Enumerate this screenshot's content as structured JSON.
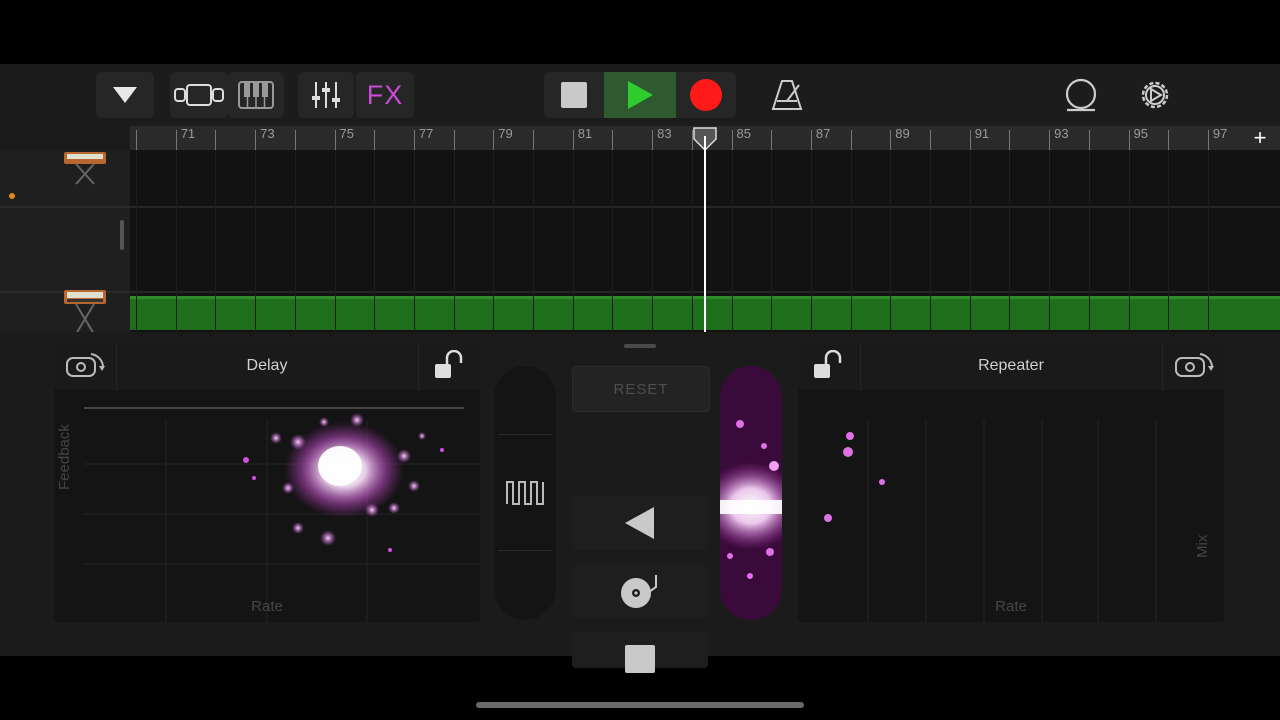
{
  "toolbar": {
    "fx_label": "FX",
    "icons": [
      "dropdown-arrow-icon",
      "tracks-view-icon",
      "keyboard-icon",
      "mixer-icon",
      "stop-icon",
      "play-icon",
      "record-icon",
      "metronome-icon",
      "loop-icon",
      "settings-icon"
    ],
    "colors": {
      "fx": "#c84bd6",
      "play": "#2ecc2e",
      "record": "#ff1a1a"
    }
  },
  "ruler": {
    "bars": [
      "71",
      "73",
      "75",
      "77",
      "79",
      "81",
      "83",
      "85",
      "87",
      "89",
      "91",
      "93",
      "95",
      "97"
    ],
    "add_label": "+"
  },
  "tracks": {
    "instrument_icons": [
      "synth-icon",
      "synth-icon",
      "synth-icon"
    ],
    "region_color": "#1e6e1c"
  },
  "fx_left": {
    "title": "Delay",
    "x_label": "Rate",
    "y_label": "Feedback"
  },
  "fx_right": {
    "title": "Repeater",
    "x_label": "Rate",
    "y_label": "Mix"
  },
  "center": {
    "reset_label": "RESET"
  }
}
